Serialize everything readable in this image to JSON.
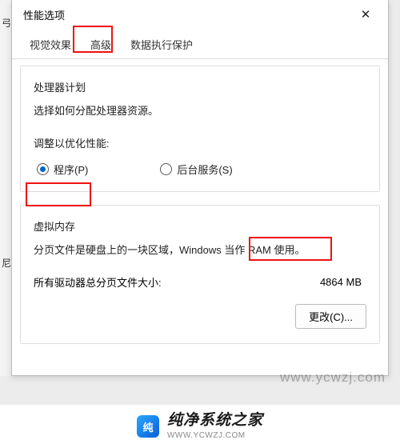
{
  "window": {
    "title": "性能选项"
  },
  "tabs": {
    "visual": "视觉效果",
    "advanced": "高级",
    "dep": "数据执行保护"
  },
  "processor": {
    "title": "处理器计划",
    "desc": "选择如何分配处理器资源。",
    "adjust_label": "调整以优化性能:",
    "radio_programs": "程序(P)",
    "radio_services": "后台服务(S)"
  },
  "vm": {
    "title": "虚拟内存",
    "desc": "分页文件是硬盘上的一块区域，Windows 当作 RAM 使用。",
    "size_label": "所有驱动器总分页文件大小:",
    "size_value": "4864 MB",
    "change_btn": "更改(C)..."
  },
  "watermark": "www.ycwzj.com",
  "footer": {
    "brand_cn": "纯净系统之家",
    "brand_en": "WWW.YCWZJ.COM"
  },
  "leftstrip": {
    "a": "弓",
    "b": "尼"
  }
}
